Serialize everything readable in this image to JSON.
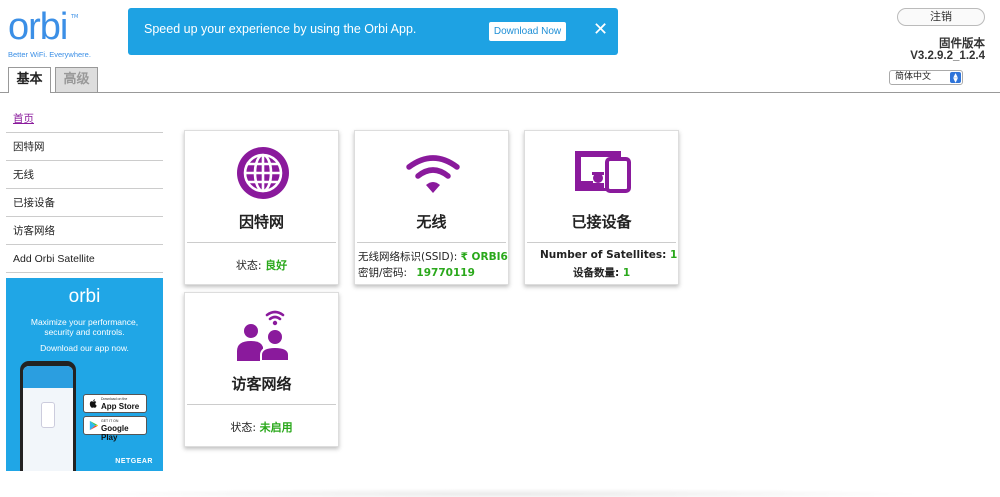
{
  "logo": {
    "word": "orbi",
    "tm": "TM",
    "tagline": "Better WiFi. Everywhere."
  },
  "banner": {
    "text": "Speed up your experience by using the Orbi App.",
    "button": "Download Now",
    "close": "✕",
    "color": "#1ea2e3"
  },
  "header": {
    "logout": "注销",
    "firmware_label": "固件版本",
    "firmware_version": "V3.2.9.2_1.2.4",
    "language": "简体中文"
  },
  "tabs": [
    {
      "label": "基本",
      "active": true
    },
    {
      "label": "高级",
      "active": false
    }
  ],
  "sidebar": {
    "items": [
      {
        "label": "首页",
        "active": true
      },
      {
        "label": "因特网"
      },
      {
        "label": "无线"
      },
      {
        "label": "已接设备"
      },
      {
        "label": "访客网络"
      },
      {
        "label": "Add Orbi Satellite"
      }
    ]
  },
  "promo": {
    "logo": "orbi",
    "line1": "Maximize your performance,",
    "line2": "security and controls.",
    "line3": "Download our app now.",
    "appstore_small": "Download on the",
    "appstore_big": "App Store",
    "googleplay_small": "GET IT ON",
    "googleplay_big": "Google Play",
    "brand": "NETGEAR"
  },
  "cards": {
    "internet": {
      "icon": "globe-icon",
      "title": "因特网",
      "status_label": "状态:",
      "status_value": "良好"
    },
    "wireless": {
      "icon": "wifi-icon",
      "title": "无线",
      "ssid_label": "无线网络标识(SSID):",
      "ssid_value": "₹ ORBI6",
      "password_label": "密钥/密码:",
      "password_value": "19770119"
    },
    "devices": {
      "icon": "devices-icon",
      "title": "已接设备",
      "satellites_label": "Number of Satellites:",
      "satellites_value": "1",
      "device_count_label": "设备数量:",
      "device_count_value": "1"
    },
    "guest": {
      "icon": "guest-network-icon",
      "title": "访客网络",
      "status_label": "状态:",
      "status_value": "未启用"
    }
  },
  "colors": {
    "accent_purple": "#8a1a9c",
    "status_green": "#2aa81b",
    "orbi_blue": "#3b8fe6"
  }
}
